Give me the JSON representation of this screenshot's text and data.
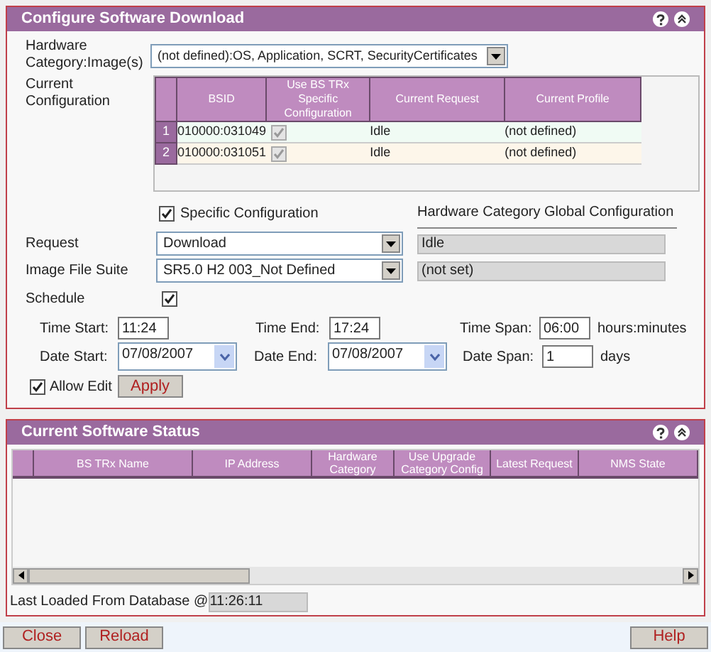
{
  "config_panel": {
    "title": "Configure Software Download",
    "hardware_label": "Hardware Category:Image(s)",
    "hardware_value": "(not defined):OS, Application, SCRT, SecurityCertificates",
    "current_label": "Current Configuration",
    "table": {
      "columns": [
        "BSID",
        "Use BS TRx Specific Configuration",
        "Current Request",
        "Current Profile"
      ],
      "rows": [
        {
          "index": "1",
          "bsid": "010000:031049",
          "specific": true,
          "request": "Idle",
          "profile": "(not defined)"
        },
        {
          "index": "2",
          "bsid": "010000:031051",
          "specific": true,
          "request": "Idle",
          "profile": "(not defined)"
        }
      ]
    },
    "specific_config": {
      "label": "Specific Configuration",
      "checked": true
    },
    "global_label": "Hardware Category Global Configuration",
    "request": {
      "label": "Request",
      "value": "Download",
      "global": "Idle"
    },
    "image_suite": {
      "label": "Image File Suite",
      "value": "SR5.0 H2 003_Not Defined",
      "global": "(not set)"
    },
    "schedule": {
      "label": "Schedule",
      "checked": true
    },
    "time_start": {
      "label": "Time Start:",
      "value": "11:24"
    },
    "time_end": {
      "label": "Time End:",
      "value": "17:24"
    },
    "time_span": {
      "label": "Time Span:",
      "value": "06:00",
      "unit": "hours:minutes"
    },
    "date_start": {
      "label": "Date Start:",
      "value": "07/08/2007"
    },
    "date_end": {
      "label": "Date End:",
      "value": "07/08/2007"
    },
    "date_span": {
      "label": "Date Span:",
      "value": "1",
      "unit": "days"
    },
    "allow_edit": {
      "label": "Allow Edit",
      "checked": true
    },
    "apply": "Apply"
  },
  "status_panel": {
    "title": "Current Software Status",
    "columns": [
      "BS TRx Name",
      "IP Address",
      "Hardware Category",
      "Use Upgrade Category Config",
      "Latest Request",
      "NMS State"
    ],
    "last_loaded_label": "Last Loaded From Database @",
    "last_loaded_value": "11:26:11"
  },
  "buttons": [
    "Close",
    "Reload",
    "Help"
  ]
}
